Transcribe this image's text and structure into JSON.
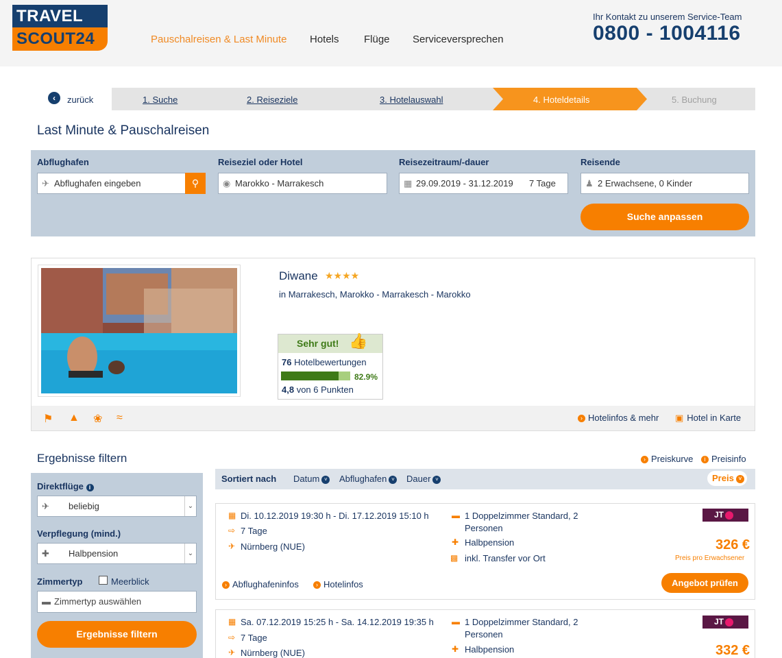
{
  "logo": {
    "top": "TRAVEL",
    "bottom": "SCOUT24"
  },
  "nav": [
    {
      "label": "Pauschalreisen & Last Minute",
      "active": true
    },
    {
      "label": "Hotels"
    },
    {
      "label": "Flüge"
    },
    {
      "label": "Serviceversprechen"
    }
  ],
  "contact": {
    "label": "Ihr Kontakt zu unserem Service-Team",
    "phone": "0800 - 1004116"
  },
  "steps": {
    "back": "zurück",
    "items": [
      "1. Suche",
      "2. Reiseziele",
      "3. Hotelauswahl",
      "4. Hoteldetails",
      "5. Buchung"
    ]
  },
  "page_title": "Last Minute & Pauschalreisen",
  "search": {
    "labels": {
      "airport": "Abflughafen",
      "destination": "Reiseziel oder Hotel",
      "period": "Reisezeitraum/-dauer",
      "travelers": "Reisende"
    },
    "airport_placeholder": "Abflughafen eingeben",
    "destination_value": "Marokko - Marrakesch",
    "period_value": "29.09.2019 - 31.12.2019",
    "duration_value": "7 Tage",
    "travelers_value": "2 Erwachsene, 0 Kinder",
    "submit": "Suche anpassen"
  },
  "hotel": {
    "name": "Diwane",
    "stars": "★★★★",
    "location": "in Marrakesch, Marokko - Marrakesch - Marokko",
    "rating_label": "Sehr gut!",
    "review_count": "76",
    "review_text": "Hotelbewertungen",
    "recommend_pct": 82.9,
    "recommend_label": "82.9%",
    "score": "4,8",
    "score_text": "von 6 Punkten",
    "link_info": "Hotelinfos & mehr",
    "link_map": "Hotel in Karte"
  },
  "filters": {
    "title": "Ergebnisse filtern",
    "direct_flights_label": "Direktflüge",
    "direct_flights_value": "beliebig",
    "board_label": "Verpflegung (mind.)",
    "board_value": "Halbpension",
    "room_label": "Zimmertyp",
    "seaview_label": "Meerblick",
    "room_placeholder": "Zimmertyp auswählen",
    "submit": "Ergebnisse filtern"
  },
  "results": {
    "link_curve": "Preiskurve",
    "link_info": "Preisinfo",
    "sort_label": "Sortiert nach",
    "sort_options": [
      "Datum",
      "Abflughafen",
      "Dauer"
    ],
    "sort_active": "Preis"
  },
  "offers": [
    {
      "dates": "Di. 10.12.2019 19:30 h - Di. 17.12.2019 15:10 h",
      "duration": "7 Tage",
      "airport": "Nürnberg (NUE)",
      "room_line1": "1 Doppelzimmer Standard, 2",
      "room_line2": "Personen",
      "board": "Halbpension",
      "transfer": "inkl. Transfer vor Ort",
      "operator": "JT",
      "price": "326 €",
      "price_note": "Preis pro Erwachsener",
      "link_airport": "Abflughafeninfos",
      "link_hotel": "Hotelinfos",
      "button": "Angebot prüfen"
    },
    {
      "dates": "Sa. 07.12.2019 15:25 h - Sa. 14.12.2019 19:35 h",
      "duration": "7 Tage",
      "airport": "Nürnberg (NUE)",
      "room_line1": "1 Doppelzimmer Standard, 2",
      "room_line2": "Personen",
      "board": "Halbpension",
      "operator": "JT",
      "price": "332 €"
    }
  ],
  "colors": {
    "accent": "#f77f00",
    "brand": "#163f6e",
    "panel": "#c1cedb",
    "rating_green": "#3e7a17"
  }
}
